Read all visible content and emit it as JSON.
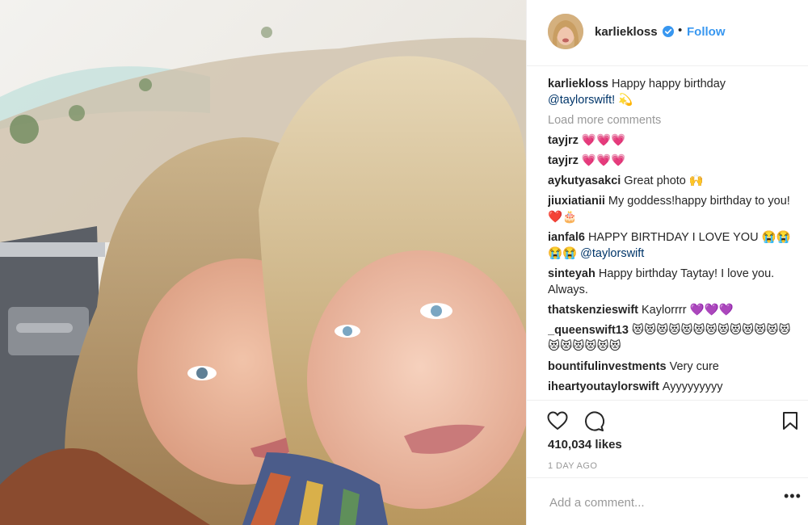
{
  "post": {
    "username": "karliekloss",
    "follow_label": "Follow",
    "separator": "•"
  },
  "caption": {
    "user": "karliekloss",
    "text": "Happy happy birthday",
    "mention": "@taylorswift!",
    "emoji": "💫"
  },
  "load_more": "Load more comments",
  "comments": [
    {
      "user": "tayjrz",
      "text": "💗💗💗"
    },
    {
      "user": "tayjrz",
      "text": "💗💗💗"
    },
    {
      "user": "aykutyasakci",
      "text": "Great photo 🙌"
    },
    {
      "user": "jiuxiatianii",
      "text": "My goddess!happy birthday to you!❤️🎂"
    },
    {
      "user": "ianfal6",
      "text": "HAPPY BIRTHDAY I LOVE YOU 😭😭😭😭",
      "mention": "@taylorswift"
    },
    {
      "user": "sinteyah",
      "text": "Happy birthday Taytay! I love you. Always."
    },
    {
      "user": "thatskenzieswift",
      "text": "Kaylorrrr 💜💜💜"
    },
    {
      "user": "_queenswift13",
      "text": "😻😻😻😻😻😻😻😻😻😻😻😻😻😻😻😻😻😻😻"
    },
    {
      "user": "bountifulinvestments",
      "text": "Very cure"
    },
    {
      "user": "iheartyoutaylorswift",
      "text": "Ayyyyyyyyy"
    }
  ],
  "likes": "410,034 likes",
  "time_ago": "1 DAY AGO",
  "add_comment_placeholder": "Add a comment...",
  "more_options": "•••",
  "icons": {
    "like": "heart-icon",
    "comment": "comment-bubble-icon",
    "save": "bookmark-icon",
    "verified": "verified-badge-icon"
  },
  "colors": {
    "link_blue": "#3897f0",
    "mention_blue": "#003569",
    "muted_gray": "#999999",
    "text_dark": "#262626"
  }
}
